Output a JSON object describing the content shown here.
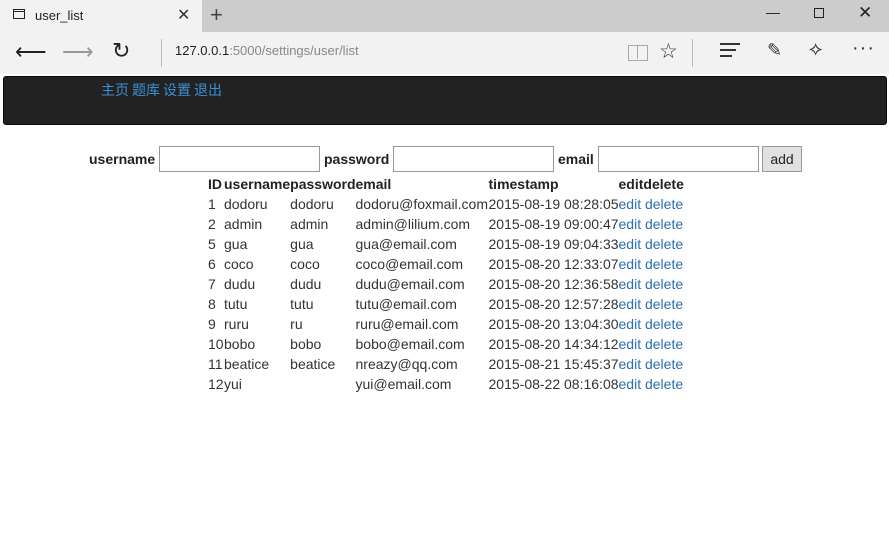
{
  "browser": {
    "tab_title": "user_list",
    "url_host": "127.0.0.1",
    "url_path": ":5000/settings/user/list"
  },
  "nav": {
    "links": [
      "主页",
      "题库",
      "设置",
      "退出"
    ]
  },
  "form": {
    "username_label": "username",
    "password_label": "password",
    "email_label": "email",
    "username_value": "",
    "password_value": "",
    "email_value": "",
    "add_label": "add"
  },
  "table": {
    "headers": [
      "ID",
      "username",
      "password",
      "email",
      "timestamp",
      "edit",
      "delete"
    ],
    "rows": [
      {
        "id": "1",
        "username": "dodoru",
        "password": "dodoru",
        "email": "dodoru@foxmail.com",
        "timestamp": "2015-08-19 08:28:05",
        "edit": "edit",
        "delete": "delete"
      },
      {
        "id": "2",
        "username": "admin",
        "password": "admin",
        "email": "admin@lilium.com",
        "timestamp": "2015-08-19 09:00:47",
        "edit": "edit",
        "delete": "delete"
      },
      {
        "id": "5",
        "username": "gua",
        "password": "gua",
        "email": "gua@email.com",
        "timestamp": "2015-08-19 09:04:33",
        "edit": "edit",
        "delete": "delete"
      },
      {
        "id": "6",
        "username": "coco",
        "password": "coco",
        "email": "coco@email.com",
        "timestamp": "2015-08-20 12:33:07",
        "edit": "edit",
        "delete": "delete"
      },
      {
        "id": "7",
        "username": "dudu",
        "password": "dudu",
        "email": "dudu@email.com",
        "timestamp": "2015-08-20 12:36:58",
        "edit": "edit",
        "delete": "delete"
      },
      {
        "id": "8",
        "username": "tutu",
        "password": "tutu",
        "email": "tutu@email.com",
        "timestamp": "2015-08-20 12:57:28",
        "edit": "edit",
        "delete": "delete"
      },
      {
        "id": "9",
        "username": "ruru",
        "password": "ru",
        "email": "ruru@email.com",
        "timestamp": "2015-08-20 13:04:30",
        "edit": "edit",
        "delete": "delete"
      },
      {
        "id": "10",
        "username": "bobo",
        "password": "bobo",
        "email": "bobo@email.com",
        "timestamp": "2015-08-20 14:34:12",
        "edit": "edit",
        "delete": "delete"
      },
      {
        "id": "11",
        "username": "beatice",
        "password": "beatice",
        "email": "nreazy@qq.com",
        "timestamp": "2015-08-21 15:45:37",
        "edit": "edit",
        "delete": "delete"
      },
      {
        "id": "12",
        "username": "yui",
        "password": "",
        "email": "yui@email.com",
        "timestamp": "2015-08-22 08:16:08",
        "edit": "edit",
        "delete": "delete"
      }
    ]
  },
  "colors": {
    "header_bg": "#222222",
    "link": "#2a6fb0",
    "nav_link": "#3a8fd6"
  },
  "icons": [
    "page-icon",
    "close-icon",
    "plus-icon",
    "minimize-icon",
    "maximize-icon",
    "back-arrow-icon",
    "forward-arrow-icon",
    "refresh-icon",
    "reading-view-icon",
    "star-icon",
    "hub-icon",
    "web-note-icon",
    "share-icon",
    "more-icon"
  ]
}
